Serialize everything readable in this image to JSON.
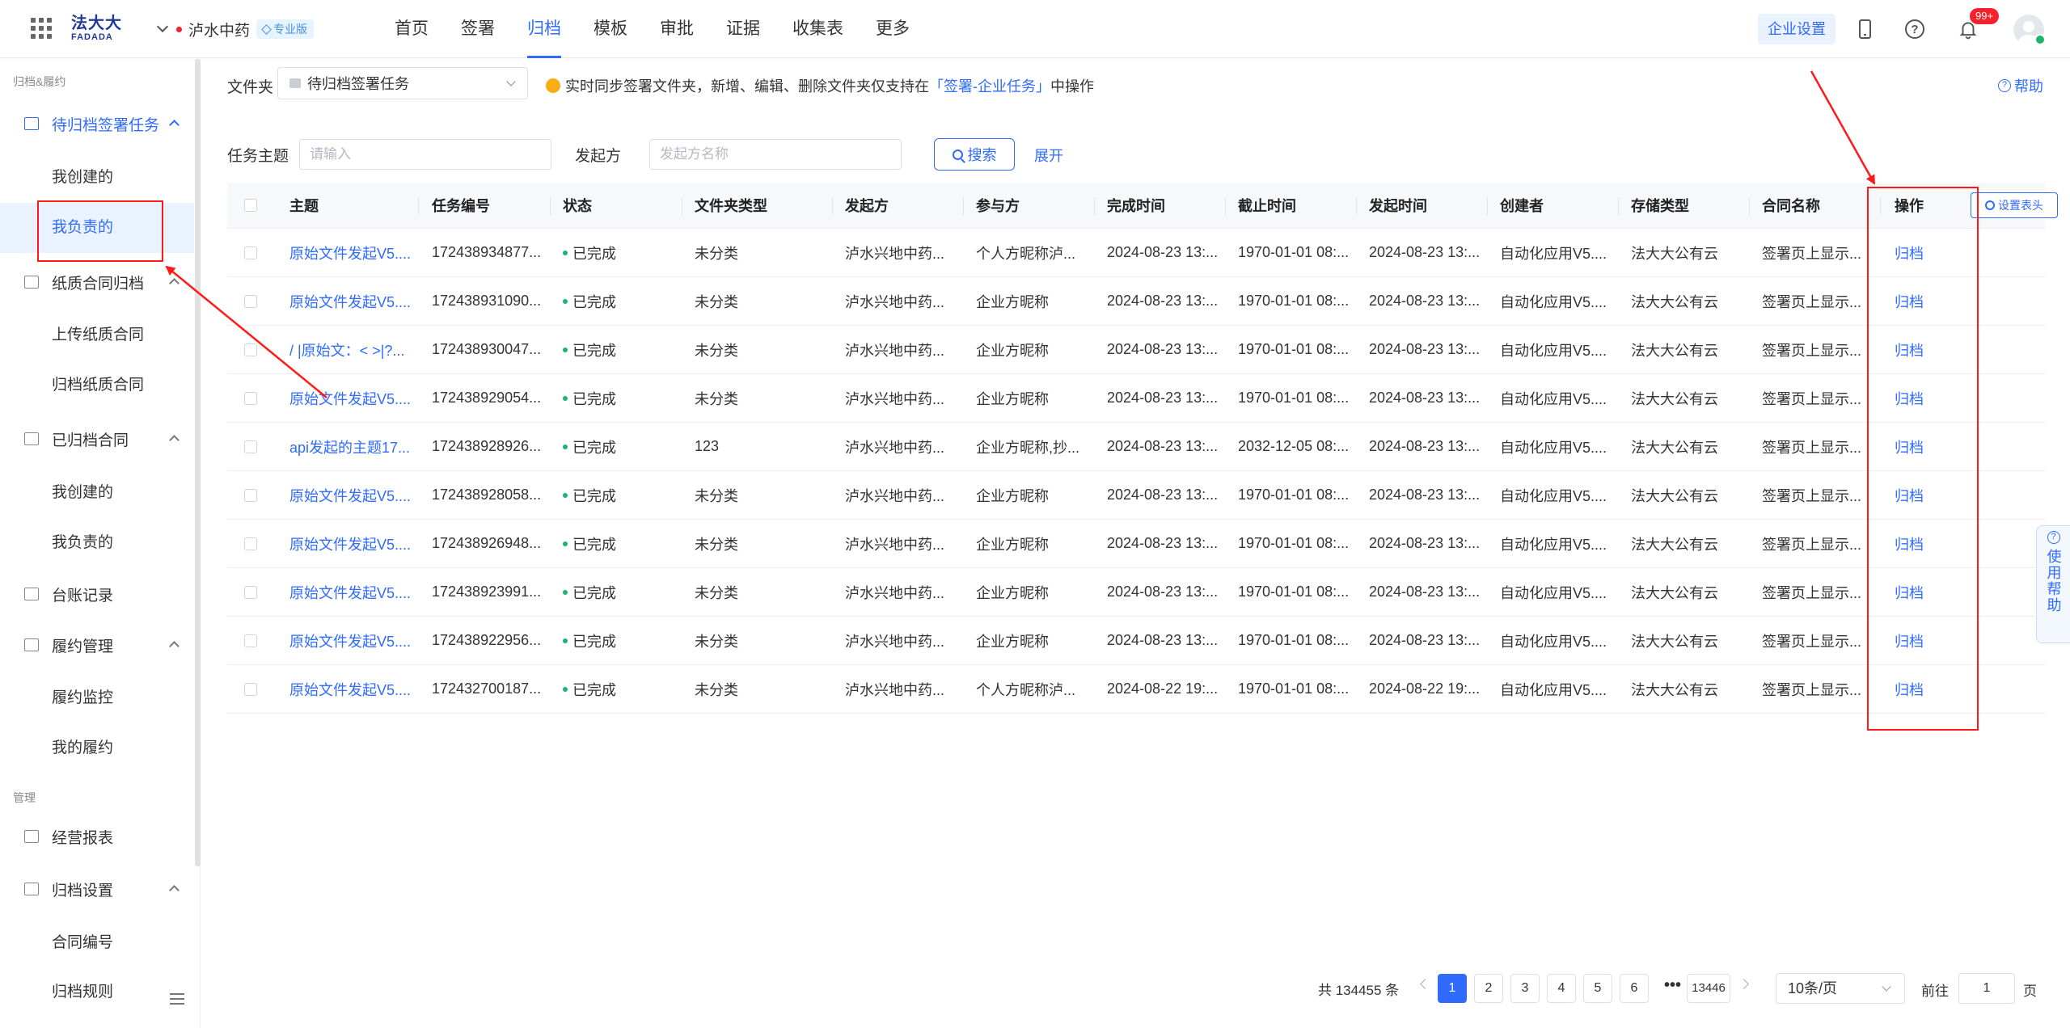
{
  "header": {
    "logo_top": "法大大",
    "logo_bottom": "FADADA",
    "org_name": "泸水中药",
    "org_badge": "专业版",
    "nav": [
      "首页",
      "签署",
      "归档",
      "模板",
      "审批",
      "证据",
      "收集表",
      "更多"
    ],
    "active_nav_index": 2,
    "enterprise_settings": "企业设置",
    "notification_count": "99+"
  },
  "sidebar": {
    "section_archive": "归档&履约",
    "pending_group": "待归档签署任务",
    "pending_items": [
      "我创建的",
      "我负责的"
    ],
    "paper_group": "纸质合同归档",
    "paper_items": [
      "上传纸质合同",
      "归档纸质合同"
    ],
    "archived_group": "已归档合同",
    "archived_items": [
      "我创建的",
      "我负责的"
    ],
    "ledger": "台账记录",
    "perf_group": "履约管理",
    "perf_items": [
      "履约监控",
      "我的履约"
    ],
    "section_manage": "管理",
    "reports": "经营报表",
    "settings_group": "归档设置",
    "settings_items": [
      "合同编号",
      "归档规则"
    ]
  },
  "toolbar": {
    "folder_label": "文件夹",
    "folder_value": "待归档签署任务",
    "tip_prefix": "实时同步签署文件夹，新增、编辑、删除文件夹仅支持在",
    "tip_link": "「签署-企业任务」",
    "tip_suffix": "中操作",
    "help": "帮助"
  },
  "filters": {
    "subject_label": "任务主题",
    "subject_placeholder": "请输入",
    "initiator_label": "发起方",
    "initiator_placeholder": "发起方名称",
    "search": "搜索",
    "expand": "展开"
  },
  "table": {
    "columns": [
      "主题",
      "任务编号",
      "状态",
      "文件夹类型",
      "发起方",
      "参与方",
      "完成时间",
      "截止时间",
      "发起时间",
      "创建者",
      "存储类型",
      "合同名称",
      "操作"
    ],
    "settings_button": "设置表头",
    "rows": [
      {
        "subject": "原始文件发起V5....",
        "task_no": "172438934877...",
        "status": "已完成",
        "folder_type": "未分类",
        "initiator": "泸水兴地中药...",
        "participant": "个人方昵称泸...",
        "completed": "2024-08-23 13:...",
        "deadline": "1970-01-01 08:...",
        "initiated": "2024-08-23 13:...",
        "creator": "自动化应用V5....",
        "storage": "法大大公有云",
        "contract": "签署页上显示...",
        "action": "归档"
      },
      {
        "subject": "原始文件发起V5....",
        "task_no": "172438931090...",
        "status": "已完成",
        "folder_type": "未分类",
        "initiator": "泸水兴地中药...",
        "participant": "企业方昵称",
        "completed": "2024-08-23 13:...",
        "deadline": "1970-01-01 08:...",
        "initiated": "2024-08-23 13:...",
        "creator": "自动化应用V5....",
        "storage": "法大大公有云",
        "contract": "签署页上显示...",
        "action": "归档"
      },
      {
        "subject": "/ |原始文：< >|?...",
        "task_no": "172438930047...",
        "status": "已完成",
        "folder_type": "未分类",
        "initiator": "泸水兴地中药...",
        "participant": "企业方昵称",
        "completed": "2024-08-23 13:...",
        "deadline": "1970-01-01 08:...",
        "initiated": "2024-08-23 13:...",
        "creator": "自动化应用V5....",
        "storage": "法大大公有云",
        "contract": "签署页上显示...",
        "action": "归档"
      },
      {
        "subject": "原始文件发起V5....",
        "task_no": "172438929054...",
        "status": "已完成",
        "folder_type": "未分类",
        "initiator": "泸水兴地中药...",
        "participant": "企业方昵称",
        "completed": "2024-08-23 13:...",
        "deadline": "1970-01-01 08:...",
        "initiated": "2024-08-23 13:...",
        "creator": "自动化应用V5....",
        "storage": "法大大公有云",
        "contract": "签署页上显示...",
        "action": "归档"
      },
      {
        "subject": "api发起的主题17...",
        "task_no": "172438928926...",
        "status": "已完成",
        "folder_type": "123",
        "initiator": "泸水兴地中药...",
        "participant": "企业方昵称,抄...",
        "completed": "2024-08-23 13:...",
        "deadline": "2032-12-05 08:...",
        "initiated": "2024-08-23 13:...",
        "creator": "自动化应用V5....",
        "storage": "法大大公有云",
        "contract": "签署页上显示...",
        "action": "归档"
      },
      {
        "subject": "原始文件发起V5....",
        "task_no": "172438928058...",
        "status": "已完成",
        "folder_type": "未分类",
        "initiator": "泸水兴地中药...",
        "participant": "企业方昵称",
        "completed": "2024-08-23 13:...",
        "deadline": "1970-01-01 08:...",
        "initiated": "2024-08-23 13:...",
        "creator": "自动化应用V5....",
        "storage": "法大大公有云",
        "contract": "签署页上显示...",
        "action": "归档"
      },
      {
        "subject": "原始文件发起V5....",
        "task_no": "172438926948...",
        "status": "已完成",
        "folder_type": "未分类",
        "initiator": "泸水兴地中药...",
        "participant": "企业方昵称",
        "completed": "2024-08-23 13:...",
        "deadline": "1970-01-01 08:...",
        "initiated": "2024-08-23 13:...",
        "creator": "自动化应用V5....",
        "storage": "法大大公有云",
        "contract": "签署页上显示...",
        "action": "归档"
      },
      {
        "subject": "原始文件发起V5....",
        "task_no": "172438923991...",
        "status": "已完成",
        "folder_type": "未分类",
        "initiator": "泸水兴地中药...",
        "participant": "企业方昵称",
        "completed": "2024-08-23 13:...",
        "deadline": "1970-01-01 08:...",
        "initiated": "2024-08-23 13:...",
        "creator": "自动化应用V5....",
        "storage": "法大大公有云",
        "contract": "签署页上显示...",
        "action": "归档"
      },
      {
        "subject": "原始文件发起V5....",
        "task_no": "172438922956...",
        "status": "已完成",
        "folder_type": "未分类",
        "initiator": "泸水兴地中药...",
        "participant": "企业方昵称",
        "completed": "2024-08-23 13:...",
        "deadline": "1970-01-01 08:...",
        "initiated": "2024-08-23 13:...",
        "creator": "自动化应用V5....",
        "storage": "法大大公有云",
        "contract": "签署页上显示...",
        "action": "归档"
      },
      {
        "subject": "原始文件发起V5....",
        "task_no": "172432700187...",
        "status": "已完成",
        "folder_type": "未分类",
        "initiator": "泸水兴地中药...",
        "participant": "个人方昵称泸...",
        "completed": "2024-08-22 19:...",
        "deadline": "1970-01-01 08:...",
        "initiated": "2024-08-22 19:...",
        "creator": "自动化应用V5....",
        "storage": "法大大公有云",
        "contract": "签署页上显示...",
        "action": "归档"
      }
    ]
  },
  "pagination": {
    "total": "共 134455 条",
    "pages": [
      "1",
      "2",
      "3",
      "4",
      "5",
      "6"
    ],
    "ellipsis": "•••",
    "last_page": "13446",
    "page_size": "10条/页",
    "goto_label": "前往",
    "goto_value": "1",
    "goto_suffix": "页"
  },
  "float_help": "使用帮助",
  "colors": {
    "accent": "#2f6bff",
    "annotation": "#ff1a1a",
    "status_done": "#21b36a"
  }
}
